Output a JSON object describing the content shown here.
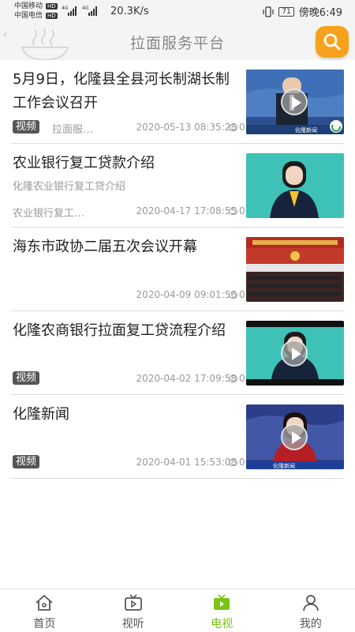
{
  "status_bar": {
    "carrier1": "中国移动",
    "carrier2": "中国电信",
    "hd": "HD",
    "speed": "20.3K/s",
    "battery": "71",
    "time": "傍晚6:49"
  },
  "header": {
    "title": "拉面服务平台",
    "search_icon": "search-icon",
    "accent_color": "#f7a21c"
  },
  "news": [
    {
      "title": "5月9日，化隆县全县河长制湖长制工作会议召开",
      "subtitle": "",
      "tag": "视频",
      "source": "拉面服…",
      "date": "2020-05-13 08:35:28",
      "comments": "0",
      "has_play": true,
      "thumb_text": "化隆新闻"
    },
    {
      "title": "农业银行复工贷款介绍",
      "subtitle": "化隆农业银行复工贷介绍",
      "tag": "",
      "source": "农业银行复工…",
      "date": "2020-04-17 17:08:55",
      "comments": "0",
      "has_play": false,
      "thumb_text": ""
    },
    {
      "title": "海东市政协二届五次会议开幕",
      "subtitle": "",
      "tag": "",
      "source": "",
      "date": "2020-04-09 09:01:56",
      "comments": "0",
      "has_play": false,
      "thumb_text": ""
    },
    {
      "title": "化隆农商银行拉面复工贷流程介绍",
      "subtitle": "",
      "tag": "视频",
      "source": "",
      "date": "2020-04-02 17:09:58",
      "comments": "0",
      "has_play": true,
      "thumb_text": ""
    },
    {
      "title": "化隆新闻",
      "subtitle": "",
      "tag": "视频",
      "source": "",
      "date": "2020-04-01 15:53:08",
      "comments": "0",
      "has_play": true,
      "thumb_text": "化隆新闻"
    }
  ],
  "bottom_nav": [
    {
      "label": "首页",
      "icon": "home-icon",
      "active": false
    },
    {
      "label": "视听",
      "icon": "tv-icon",
      "active": false
    },
    {
      "label": "电视",
      "icon": "tv-play-icon",
      "active": true
    },
    {
      "label": "我的",
      "icon": "user-icon",
      "active": false
    }
  ],
  "colors": {
    "active_nav": "#7cc316",
    "tag_bg": "#555555"
  }
}
